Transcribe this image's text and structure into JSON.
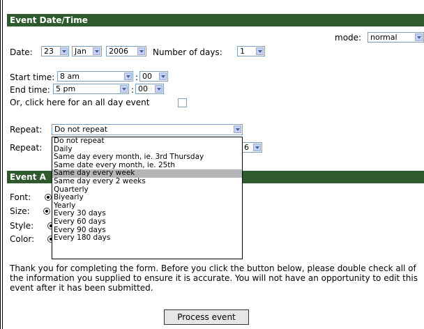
{
  "section1": {
    "title": "Event Date/Time"
  },
  "mode": {
    "label": "mode:",
    "value": "normal"
  },
  "date": {
    "label": "Date:",
    "day": "23",
    "month": "Jan",
    "year": "2006"
  },
  "days": {
    "label": "Number of days:",
    "value": "1"
  },
  "start": {
    "label": "Start time:",
    "hour": "8 am",
    "sep": ":",
    "min": "00"
  },
  "end": {
    "label": "End time:",
    "hour": "5 pm",
    "sep": ":",
    "min": "00"
  },
  "allday": {
    "label": "Or, click here for an all day event"
  },
  "repeat": {
    "label": "Repeat:",
    "value": "Do not repeat"
  },
  "repeat2": {
    "label": "Repeat:",
    "value_tail": "6"
  },
  "repeat_options": [
    "Do not repeat",
    "Daily",
    "Same day every month, ie. 3rd Thursday",
    "Same date every month, ie. 25th",
    "Same day every week",
    "Same day every 2 weeks",
    "Quarterly",
    "Biyearly",
    "Yearly",
    "Every 30 days",
    "Every 60 days",
    "Every 90 days",
    "Every 180 days"
  ],
  "section2": {
    "title_visible": "Event A"
  },
  "appearance": {
    "font": "Font:",
    "size": "Size:",
    "style": "Style:",
    "color": "Color:"
  },
  "notice": "Thank you for completing the form. Before you click the button below, please double check all of the information you supplied to ensure it is accurate. You will not have an opportunity to edit this event after it has been submitted.",
  "submit": {
    "label": "Process event"
  }
}
